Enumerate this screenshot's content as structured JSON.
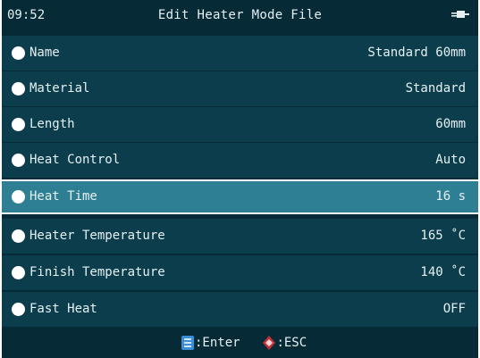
{
  "header": {
    "time": "09:52",
    "title": "Edit Heater Mode File",
    "battery_icon": "plug-icon"
  },
  "rows": [
    {
      "label": "Name",
      "value": "Standard 60mm"
    },
    {
      "label": "Material",
      "value": "Standard"
    },
    {
      "label": "Length",
      "value": "60mm"
    },
    {
      "label": "Heat Control",
      "value": "Auto"
    },
    {
      "label": "Heat Time",
      "value": "16 s",
      "selected": true
    },
    {
      "label": "Heater Temperature",
      "value": "165 ˚C"
    },
    {
      "label": "Finish Temperature",
      "value": "140 ˚C"
    },
    {
      "label": "Fast Heat",
      "value": "OFF"
    }
  ],
  "footer": {
    "enter_label": ":Enter",
    "esc_label": ":ESC",
    "enter_icon": "enter-key-icon",
    "esc_icon": "esc-key-icon"
  },
  "colors": {
    "background": "#062b36",
    "row": "#0b3d4c",
    "selected_row": "#2e7f93",
    "text": "#e6f0f2",
    "accent_blue": "#3a8fd8",
    "accent_red": "#c0303a"
  }
}
